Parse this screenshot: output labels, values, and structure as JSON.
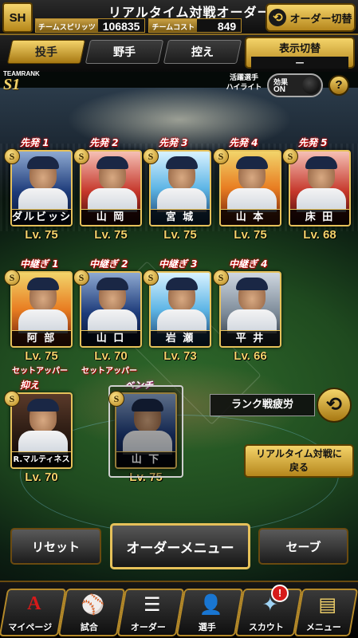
{
  "header": {
    "title": "リアルタイム対戦オーダー",
    "team_spirit_label": "チームスピリッツ",
    "team_spirit_value": "106835",
    "team_cost_label": "チームコスト",
    "team_cost_value": "849",
    "order_switch_label": "オーダー切替",
    "logo_text": "SH"
  },
  "tabs": [
    {
      "label": "投手",
      "active": true
    },
    {
      "label": "野手",
      "active": false
    },
    {
      "label": "控え",
      "active": false
    }
  ],
  "display_toggle": {
    "label": "表示切替",
    "value": "—"
  },
  "team_rank": {
    "label": "TEAMRANK",
    "value": "S1"
  },
  "highlight": {
    "label_line1": "活躍選手",
    "label_line2": "ハイライト",
    "effect_label": "効果",
    "effect_value": "ON"
  },
  "starters": [
    {
      "slot": "先発 1",
      "name": "ダルビッシュ",
      "level": "Lv. 75",
      "theme": "blue"
    },
    {
      "slot": "先発 2",
      "name": "山 岡",
      "level": "Lv. 75",
      "theme": "red"
    },
    {
      "slot": "先発 3",
      "name": "宮 城",
      "level": "Lv. 75",
      "theme": "ice"
    },
    {
      "slot": "先発 4",
      "name": "山 本",
      "level": "Lv. 75",
      "theme": "fire"
    },
    {
      "slot": "先発 5",
      "name": "床 田",
      "level": "Lv. 68",
      "theme": "red"
    }
  ],
  "relievers": [
    {
      "slot": "中継ぎ 1",
      "name": "阿 部",
      "level": "Lv. 75",
      "role": "セットアッパー",
      "theme": "fire"
    },
    {
      "slot": "中継ぎ 2",
      "name": "山 口",
      "level": "Lv. 70",
      "role": "セットアッパー",
      "theme": "blue"
    },
    {
      "slot": "中継ぎ 3",
      "name": "岩 瀬",
      "level": "Lv. 73",
      "role": "",
      "theme": "ice"
    },
    {
      "slot": "中継ぎ 4",
      "name": "平 井",
      "level": "Lv. 66",
      "role": "",
      "theme": "gray"
    }
  ],
  "closer": {
    "slot": "抑え",
    "name": "R.マルティネス",
    "level": "Lv. 70",
    "theme": "dark"
  },
  "bench": {
    "slot": "ベンチ",
    "name": "山 下",
    "level": "Lv. 75",
    "theme": "blue"
  },
  "badge_text": "S",
  "fatigue_label": "ランク戦疲労",
  "back_button": {
    "line1": "リアルタイム対戦に",
    "line2": "戻る"
  },
  "actions": {
    "reset": "リセット",
    "order_menu": "オーダーメニュー",
    "save": "セーブ"
  },
  "nav": [
    {
      "label": "マイページ",
      "icon": "A"
    },
    {
      "label": "試合",
      "icon": "⚾"
    },
    {
      "label": "オーダー",
      "icon": "☰"
    },
    {
      "label": "選手",
      "icon": "👤"
    },
    {
      "label": "スカウト",
      "icon": "✦"
    },
    {
      "label": "メニュー",
      "icon": "▤"
    }
  ],
  "scout_notification": "!",
  "colors": {
    "gold": "#f3d36a",
    "accent_red": "#d61a1a",
    "frame_gold": "#e6c15a"
  }
}
